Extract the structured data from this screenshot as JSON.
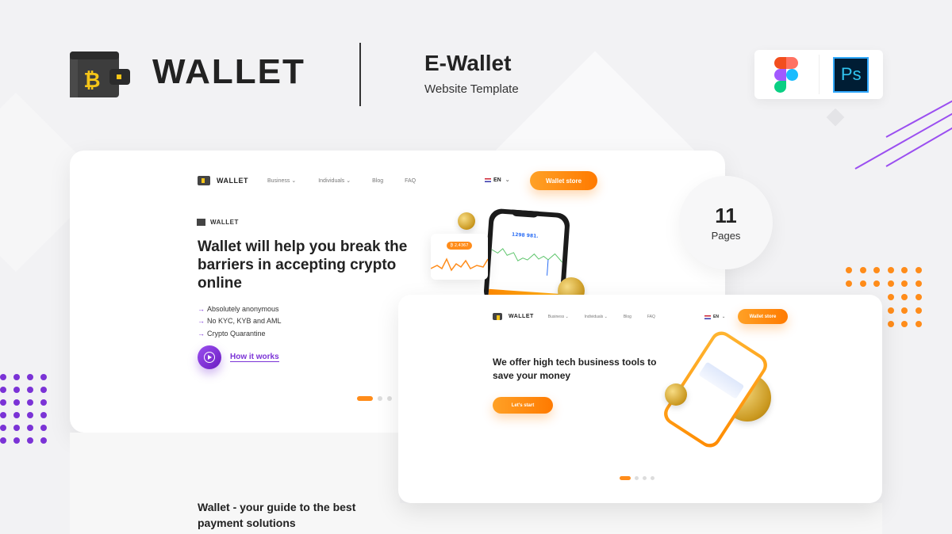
{
  "header": {
    "brand_name": "WALLET",
    "product_title": "E-Wallet",
    "product_subtitle": "Website Template",
    "tools": [
      {
        "icon": "figma-icon",
        "label": "Figma"
      },
      {
        "icon": "photoshop-icon",
        "label": "Ps"
      }
    ]
  },
  "badge": {
    "count": "11",
    "label": "Pages"
  },
  "colors": {
    "accent_orange": "#ff8c1a",
    "accent_purple": "#7b33d6",
    "text_dark": "#222222"
  },
  "preview_home": {
    "nav": {
      "brand": "WALLET",
      "links": [
        "Business ⌄",
        "Individuals ⌄",
        "Blog",
        "FAQ"
      ],
      "language": "EN",
      "cta": "Wallet store"
    },
    "hero": {
      "brand": "WALLET",
      "title": "Wallet will help you break the barriers in accepting crypto online",
      "features": [
        "Absolutely anonymous",
        "No KYC, KYB and AML",
        "Crypto Quarantine"
      ],
      "link": "How it works"
    },
    "mockup": {
      "balance": "1298 981.",
      "pill_value": "₿ 2,4367"
    },
    "pager": {
      "total": 3,
      "active": 1
    }
  },
  "preview_business": {
    "nav": {
      "brand": "WALLET",
      "links": [
        "Business ⌄",
        "Individuals ⌄",
        "Blog",
        "FAQ"
      ],
      "language": "EN",
      "cta": "Wallet store"
    },
    "hero": {
      "title": "We offer high tech business tools to save your money",
      "cta": "Let's start"
    },
    "pager": {
      "total": 4,
      "active": 1
    }
  },
  "section": {
    "title": "Wallet - your guide to the best payment solutions"
  }
}
